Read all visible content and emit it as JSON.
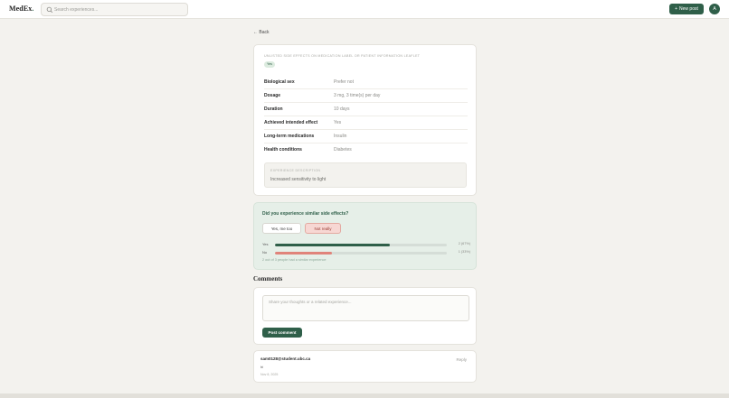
{
  "header": {
    "logo_text": "MedEx",
    "logo_dot": ".",
    "search_placeholder": "Search experiences...",
    "new_post_label": "New post",
    "avatar_initial": "A"
  },
  "nav": {
    "back_label": "← Back"
  },
  "post": {
    "category": "UNLISTED SIDE EFFECTS ON MEDICATION LABEL OR PATIENT INFORMATION LEAFLET",
    "badge": "Yes",
    "fields": [
      {
        "label": "Biological sex",
        "value": "Prefer not"
      },
      {
        "label": "Dosage",
        "value": "3 mg, 3 time(s) per day"
      },
      {
        "label": "Duration",
        "value": "10 days"
      },
      {
        "label": "Achieved intended effect",
        "value": "Yes"
      },
      {
        "label": "Long-term medications",
        "value": "Insulin"
      },
      {
        "label": "Health conditions",
        "value": "Diabetes"
      }
    ],
    "description_heading": "EXPERIENCE DESCRIPTION",
    "description_text": "Increased sensitivity to light"
  },
  "poll": {
    "question": "Did you experience similar side effects?",
    "yes_button": "Yes, me too",
    "no_button": "Not really",
    "results": [
      {
        "label": "Yes",
        "count_text": "2 (67%)",
        "fraction": 0.67,
        "color": "#2f5f49"
      },
      {
        "label": "No",
        "count_text": "1 (33%)",
        "fraction": 0.33,
        "color": "#e0837a"
      }
    ],
    "summary": "2 out of 3 people had a similar experience"
  },
  "comments": {
    "title": "Comments",
    "placeholder": "Share your thoughts or a related experience...",
    "post_button": "Post comment",
    "items": [
      {
        "author": "sam0128@student.ubc.ca",
        "reply_label": "Reply",
        "body": "hi",
        "date": "Nov 8, 2025"
      }
    ]
  },
  "colors": {
    "accent": "#2f5f49",
    "background": "#f3f2ee"
  }
}
